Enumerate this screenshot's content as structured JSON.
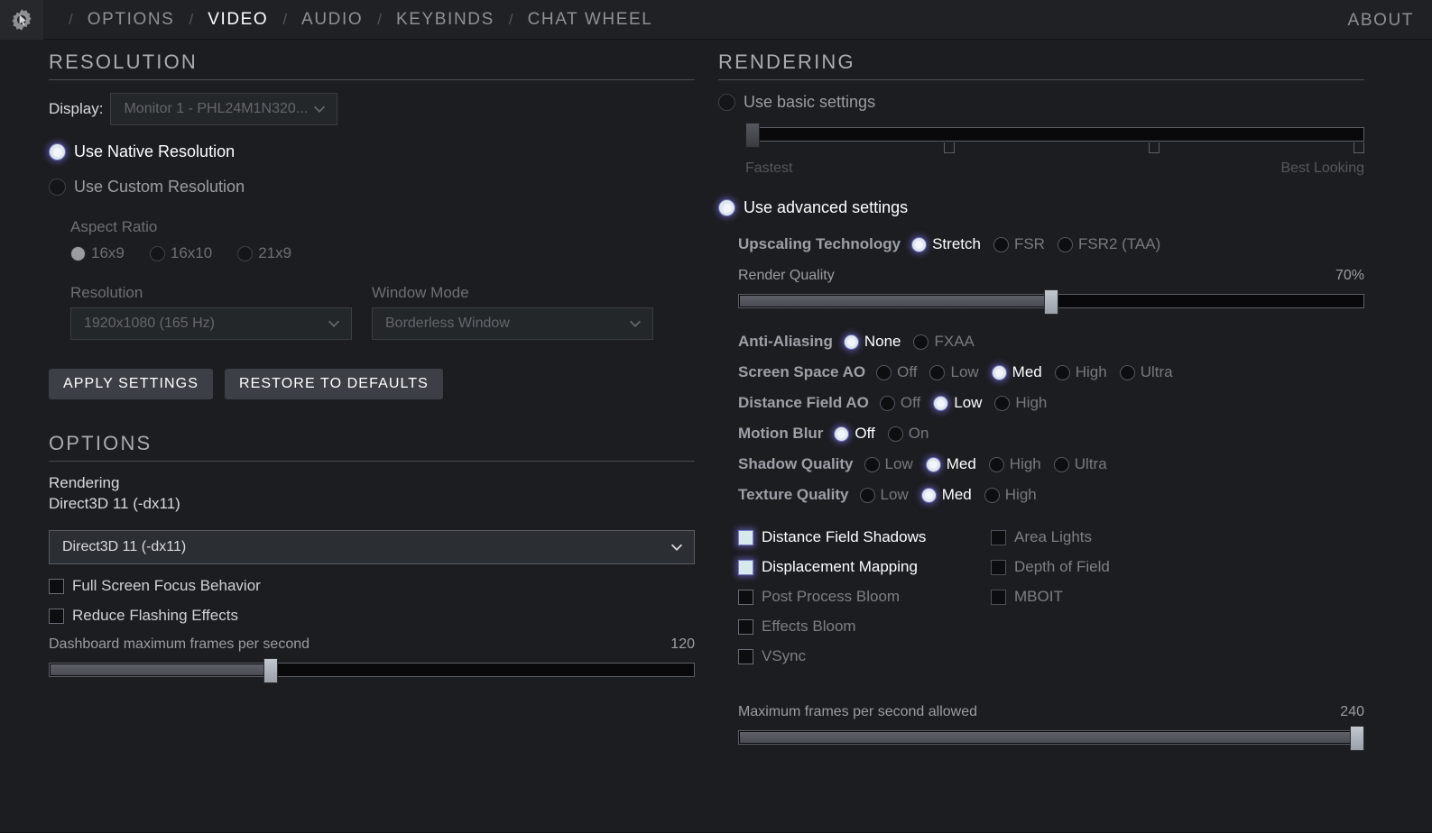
{
  "nav": {
    "gear_icon": "gear-cursor-icon",
    "separator": "/",
    "items": [
      {
        "label": "OPTIONS",
        "active": false
      },
      {
        "label": "VIDEO",
        "active": true
      },
      {
        "label": "AUDIO",
        "active": false
      },
      {
        "label": "KEYBINDS",
        "active": false
      },
      {
        "label": "CHAT WHEEL",
        "active": false
      }
    ],
    "about": "ABOUT"
  },
  "resolution": {
    "title": "RESOLUTION",
    "display_label": "Display:",
    "display_value": "Monitor 1 - PHL24M1N320...",
    "native_label": "Use Native Resolution",
    "native_selected": true,
    "custom_label": "Use Custom Resolution",
    "custom_selected": false,
    "aspect_label": "Aspect Ratio",
    "aspect_options": [
      {
        "label": "16x9",
        "selected": true
      },
      {
        "label": "16x10",
        "selected": false
      },
      {
        "label": "21x9",
        "selected": false
      }
    ],
    "resolution_label": "Resolution",
    "resolution_value": "1920x1080 (165 Hz)",
    "window_mode_label": "Window Mode",
    "window_mode_value": "Borderless Window",
    "apply_label": "APPLY SETTINGS",
    "restore_label": "RESTORE TO DEFAULTS"
  },
  "options": {
    "title": "OPTIONS",
    "rendering_label": "Rendering",
    "rendering_value": "Direct3D 11 (-dx11)",
    "rendering_select_value": "Direct3D 11 (-dx11)",
    "checkboxes": [
      {
        "label": "Full Screen Focus Behavior",
        "checked": false
      },
      {
        "label": "Reduce Flashing Effects",
        "checked": false
      }
    ],
    "dashboard_fps_label": "Dashboard maximum frames per second",
    "dashboard_fps_value": "120",
    "dashboard_fps_percent": 34
  },
  "rendering": {
    "title": "RENDERING",
    "basic_label": "Use basic settings",
    "basic_selected": false,
    "basic_slider": {
      "percent": 0,
      "min_label": "Fastest",
      "max_label": "Best Looking",
      "ticks": [
        33,
        66,
        100
      ]
    },
    "advanced_label": "Use advanced settings",
    "advanced_selected": true,
    "upscaling_label": "Upscaling Technology",
    "upscaling_options": [
      {
        "label": "Stretch",
        "selected": true
      },
      {
        "label": "FSR",
        "selected": false
      },
      {
        "label": "FSR2 (TAA)",
        "selected": false
      }
    ],
    "render_quality_label": "Render Quality",
    "render_quality_value": "70%",
    "render_quality_percent": 50,
    "quality_rows": [
      {
        "label": "Anti-Aliasing",
        "options": [
          {
            "label": "None",
            "selected": true
          },
          {
            "label": "FXAA",
            "selected": false
          }
        ]
      },
      {
        "label": "Screen Space AO",
        "options": [
          {
            "label": "Off",
            "selected": false
          },
          {
            "label": "Low",
            "selected": false
          },
          {
            "label": "Med",
            "selected": true
          },
          {
            "label": "High",
            "selected": false
          },
          {
            "label": "Ultra",
            "selected": false
          }
        ]
      },
      {
        "label": "Distance Field AO",
        "options": [
          {
            "label": "Off",
            "selected": false
          },
          {
            "label": "Low",
            "selected": true
          },
          {
            "label": "High",
            "selected": false
          }
        ]
      },
      {
        "label": "Motion Blur",
        "options": [
          {
            "label": "Off",
            "selected": true
          },
          {
            "label": "On",
            "selected": false
          }
        ]
      },
      {
        "label": "Shadow Quality",
        "options": [
          {
            "label": "Low",
            "selected": false
          },
          {
            "label": "Med",
            "selected": true
          },
          {
            "label": "High",
            "selected": false
          },
          {
            "label": "Ultra",
            "selected": false
          }
        ]
      },
      {
        "label": "Texture Quality",
        "options": [
          {
            "label": "Low",
            "selected": false
          },
          {
            "label": "Med",
            "selected": true
          },
          {
            "label": "High",
            "selected": false
          }
        ]
      }
    ],
    "checkbox_col1": [
      {
        "label": "Distance Field Shadows",
        "checked": true
      },
      {
        "label": "Displacement Mapping",
        "checked": true
      },
      {
        "label": "Post Process Bloom",
        "checked": false
      },
      {
        "label": "Effects Bloom",
        "checked": false
      },
      {
        "label": "VSync",
        "checked": false
      }
    ],
    "checkbox_col2": [
      {
        "label": "Area Lights",
        "checked": false
      },
      {
        "label": "Depth of Field",
        "checked": false
      },
      {
        "label": "MBOIT",
        "checked": false
      }
    ],
    "max_fps_label": "Maximum frames per second allowed",
    "max_fps_value": "240",
    "max_fps_percent": 100
  },
  "colors": {
    "background": "#1c1d21",
    "accent_glow": "#7a7ec6",
    "active_text": "#ffffff",
    "dim_text": "#6d6f75"
  }
}
